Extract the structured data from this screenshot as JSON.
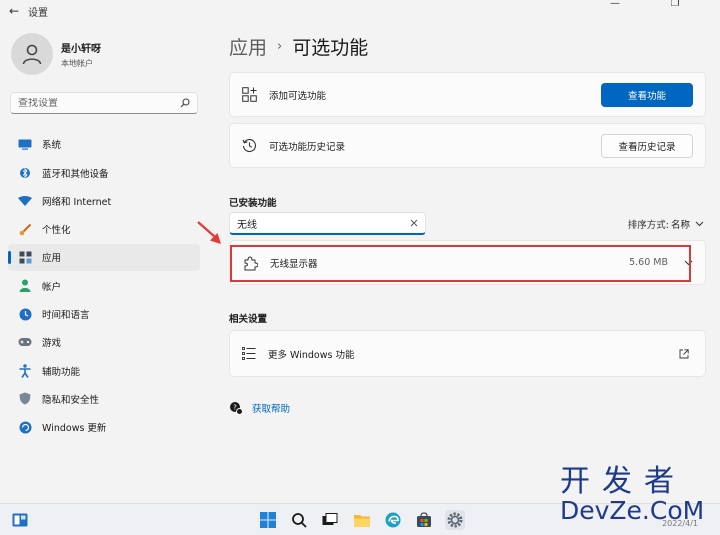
{
  "window": {
    "title": "设置",
    "back_glyph": "←",
    "minimize_glyph": "—",
    "maximize_glyph": "❐",
    "close_glyph": "✕"
  },
  "profile": {
    "name": "是小轩呀",
    "account": "本地帐户"
  },
  "search": {
    "placeholder": "查找设置"
  },
  "sidebar": {
    "items": [
      {
        "label": "系统",
        "icon": "monitor-icon"
      },
      {
        "label": "蓝牙和其他设备",
        "icon": "bluetooth-icon"
      },
      {
        "label": "网络和 Internet",
        "icon": "wifi-icon"
      },
      {
        "label": "个性化",
        "icon": "brush-icon"
      },
      {
        "label": "应用",
        "icon": "apps-icon",
        "active": true
      },
      {
        "label": "帐户",
        "icon": "person-icon"
      },
      {
        "label": "时间和语言",
        "icon": "globe-clock-icon"
      },
      {
        "label": "游戏",
        "icon": "gamepad-icon"
      },
      {
        "label": "辅助功能",
        "icon": "accessibility-icon"
      },
      {
        "label": "隐私和安全性",
        "icon": "shield-icon"
      },
      {
        "label": "Windows 更新",
        "icon": "update-icon"
      }
    ]
  },
  "breadcrumb": {
    "parent": "应用",
    "separator": "›",
    "current": "可选功能"
  },
  "add_feature": {
    "label": "添加可选功能",
    "button": "查看功能"
  },
  "history": {
    "label": "可选功能历史记录",
    "button": "查看历史记录"
  },
  "installed": {
    "title": "已安装功能",
    "filter_value": "无线",
    "sort_label": "排序方式:",
    "sort_value": "名称",
    "items": [
      {
        "name": "无线显示器",
        "size": "5.60 MB"
      }
    ]
  },
  "related": {
    "title": "相关设置",
    "more_windows_features": "更多 Windows 功能"
  },
  "help": {
    "label": "获取帮助"
  },
  "watermark": {
    "line1": "开发者",
    "line2": "DevZe.CoM"
  },
  "taskbar": {
    "clock_date": "2022/4/1"
  },
  "colors": {
    "accent": "#0067c0",
    "highlight_box": "#d93b3b",
    "annotation_arrow": "#e53935"
  }
}
